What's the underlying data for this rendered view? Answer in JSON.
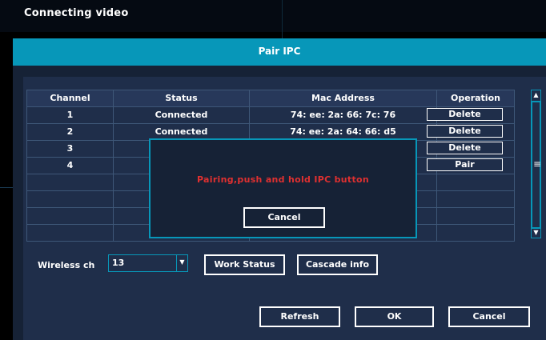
{
  "window": {
    "title": "Connecting video"
  },
  "dialog": {
    "title": "Pair IPC"
  },
  "table": {
    "headers": [
      "Channel",
      "Status",
      "Mac Address",
      "Operation"
    ],
    "rows": [
      {
        "channel": "1",
        "status": "Connected",
        "mac": "74: ee: 2a: 66: 7c: 76",
        "operation": "Delete"
      },
      {
        "channel": "2",
        "status": "Connected",
        "mac": "74: ee: 2a: 64: 66: d5",
        "operation": "Delete"
      },
      {
        "channel": "3",
        "status": "",
        "mac": "",
        "operation": "Delete"
      },
      {
        "channel": "4",
        "status": "",
        "mac": "",
        "operation": "Pair"
      }
    ]
  },
  "popup": {
    "message": "Pairing,push  and  hold  IPC  button",
    "cancel_label": "Cancel"
  },
  "wireless": {
    "label": "Wireless  ch",
    "value": "13"
  },
  "buttons": {
    "work_status": "Work  Status",
    "cascade_info": "Cascade  info",
    "refresh": "Refresh",
    "ok": "OK",
    "cancel": "Cancel"
  },
  "colors": {
    "accent": "#0797b9",
    "panel": "#1f2e4a",
    "alert": "#e03030"
  },
  "icons": {
    "scroll_up": "arrow-up-icon",
    "scroll_down": "arrow-down-icon",
    "dropdown": "dropdown-arrow-icon",
    "grip": "scroll-grip-icon"
  }
}
